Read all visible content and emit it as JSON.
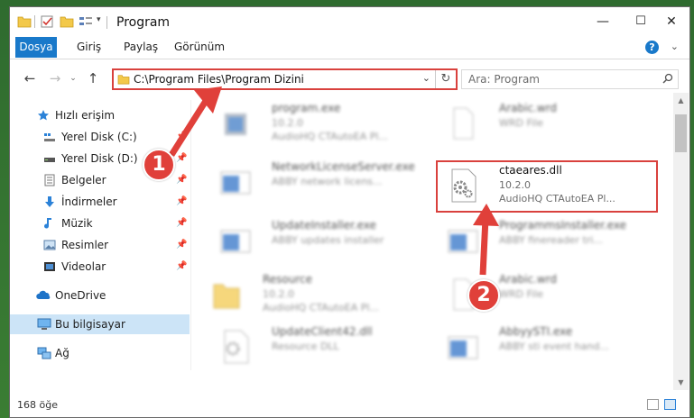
{
  "window": {
    "title": "Program",
    "controls": {
      "minimize": "—",
      "maximize": "☐",
      "close": "✕"
    }
  },
  "ribbon": {
    "tabs": [
      "Dosya",
      "Giriş",
      "Paylaş",
      "Görünüm"
    ],
    "active_tab": "Dosya",
    "help": "?"
  },
  "navigation": {
    "address_path": "C:\\Program Files\\Program Dizini",
    "search_placeholder": "Ara: Program"
  },
  "sidebar": {
    "items": [
      {
        "label": "Hızlı erişim",
        "icon": "star-icon",
        "pinned": false
      },
      {
        "label": "Yerel Disk (C:)",
        "icon": "drive-icon",
        "pinned": true
      },
      {
        "label": "Yerel Disk (D:)",
        "icon": "drive-icon",
        "pinned": true
      },
      {
        "label": "Belgeler",
        "icon": "documents-icon",
        "pinned": true
      },
      {
        "label": "İndirmeler",
        "icon": "downloads-icon",
        "pinned": true
      },
      {
        "label": "Müzik",
        "icon": "music-icon",
        "pinned": true
      },
      {
        "label": "Resimler",
        "icon": "pictures-icon",
        "pinned": true
      },
      {
        "label": "Videolar",
        "icon": "videos-icon",
        "pinned": true
      },
      {
        "label": "OneDrive",
        "icon": "onedrive-icon",
        "pinned": false
      },
      {
        "label": "Bu bilgisayar",
        "icon": "computer-icon",
        "pinned": false,
        "selected": true
      },
      {
        "label": "Ağ",
        "icon": "network-icon",
        "pinned": false
      }
    ]
  },
  "files": [
    {
      "name": "program.exe",
      "line2": "10.2.0",
      "line3": "AudioHQ CTAutoEA Pl...",
      "icon": "exe-icon",
      "blurred": true
    },
    {
      "name": "Arabic.wrd",
      "line2": "WRD File",
      "line3": "",
      "icon": "file-icon",
      "blurred": true
    },
    {
      "name": "NetworkLicenseServer.exe",
      "line2": "ABBY network licens...",
      "line3": "",
      "icon": "app-window-icon",
      "blurred": true
    },
    {
      "name": "ctaeares.dll",
      "line2": "10.2.0",
      "line3": "AudioHQ CTAutoEA Pl...",
      "icon": "dll-gear-icon",
      "blurred": false
    },
    {
      "name": "UpdateInstaller.exe",
      "line2": "ABBY updates installer",
      "line3": "",
      "icon": "app-window-icon",
      "blurred": true
    },
    {
      "name": "ProgrammsInstaller.exe",
      "line2": "ABBY finereader tri...",
      "line3": "",
      "icon": "app-window-icon",
      "blurred": true
    },
    {
      "name": "Resource",
      "line2": "10.2.0",
      "line3": "AudioHQ CTAutoEA Pl...",
      "icon": "folder-icon",
      "blurred": true
    },
    {
      "name": "Arabic.wrd",
      "line2": "WRD File",
      "line3": "",
      "icon": "file-icon",
      "blurred": true
    },
    {
      "name": "UpdateClient42.dll",
      "line2": "Resource DLL",
      "line3": "",
      "icon": "dll-gear-icon",
      "blurred": true
    },
    {
      "name": "AbbyySTI.exe",
      "line2": "ABBY sti event hand...",
      "line3": "",
      "icon": "app-window-icon",
      "blurred": true
    }
  ],
  "status": {
    "item_count": "168 öğe"
  },
  "annotations": {
    "step1": "1",
    "step2": "2"
  },
  "colors": {
    "accent": "#1979ca",
    "highlight": "#d9413d",
    "selected": "#cce4f7"
  }
}
